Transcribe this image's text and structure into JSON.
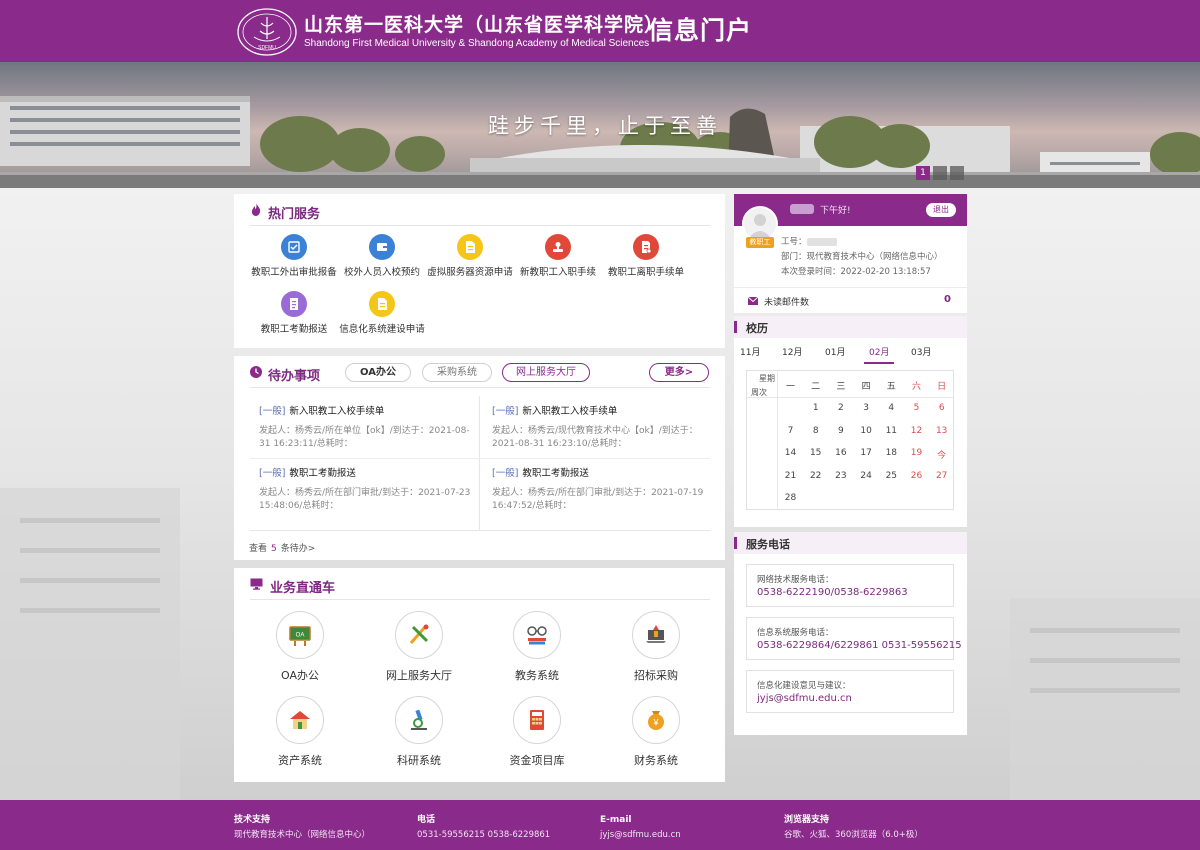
{
  "header": {
    "school_cn": "山东第一医科大学（山东省医学科学院）",
    "school_en": "Shandong First Medical University  &  Shandong Academy of Medical Sciences",
    "seal_text": "SDFMU",
    "portal_title": "信息门户"
  },
  "banner": {
    "motto": "跬步千里，止于至善",
    "slide_current": "1"
  },
  "hot_services": {
    "title": "热门服务",
    "items": [
      {
        "label": "教职工外出审批报备",
        "color": "#3b82d6",
        "icon": "approval-icon"
      },
      {
        "label": "校外人员入校预约",
        "color": "#3b82d6",
        "icon": "visitor-icon"
      },
      {
        "label": "虚拟服务器资源申请",
        "color": "#f5c518",
        "icon": "server-icon"
      },
      {
        "label": "新教职工入职手续",
        "color": "#e0483a",
        "icon": "stamp-icon"
      },
      {
        "label": "教职工离职手续单",
        "color": "#e0483a",
        "icon": "document-icon"
      },
      {
        "label": "教职工考勤报送",
        "color": "#9a6ad6",
        "icon": "attendance-icon"
      },
      {
        "label": "信息化系统建设申请",
        "color": "#f5c518",
        "icon": "build-icon"
      }
    ]
  },
  "todo": {
    "title": "待办事项",
    "tabs": [
      "OA办公",
      "采购系统",
      "网上服务大厅"
    ],
    "more": "更多>",
    "items": [
      {
        "tag": "[一般]",
        "title": "新入职教工入校手续单",
        "meta": "发起人：杨秀云/所在单位【ok】/到达于：2021-08-31 16:23:11/总耗时："
      },
      {
        "tag": "[一般]",
        "title": "新入职教工入校手续单",
        "meta": "发起人：杨秀云/现代教育技术中心【ok】/到达于：2021-08-31 16:23:10/总耗时："
      },
      {
        "tag": "[一般]",
        "title": "教职工考勤报送",
        "meta": "发起人：杨秀云/所在部门审批/到达于：2021-07-23 15:48:06/总耗时："
      },
      {
        "tag": "[一般]",
        "title": "教职工考勤报送",
        "meta": "发起人：杨秀云/所在部门审批/到达于：2021-07-19 16:47:52/总耗时："
      }
    ],
    "see_prefix": "查看",
    "see_count": "5",
    "see_suffix": "条待办>"
  },
  "business": {
    "title": "业务直通车",
    "items": [
      {
        "label": "OA办公",
        "icon": "oa-board-icon"
      },
      {
        "label": "网上服务大厅",
        "icon": "tools-icon"
      },
      {
        "label": "教务系统",
        "icon": "glasses-book-icon"
      },
      {
        "label": "招标采购",
        "icon": "laptop-icon"
      },
      {
        "label": "资产系统",
        "icon": "house-icon"
      },
      {
        "label": "科研系统",
        "icon": "microscope-icon"
      },
      {
        "label": "资金项目库",
        "icon": "calculator-icon"
      },
      {
        "label": "财务系统",
        "icon": "money-bag-icon"
      }
    ]
  },
  "user": {
    "greeting": "下午好!",
    "logout": "退出",
    "role": "教职工",
    "id_label": "工号：",
    "dept_label": "部门：",
    "dept": "现代教育技术中心（网络信息中心）",
    "login_label": "本次登录时间：",
    "login_time": "2022-02-20 13:18:57",
    "mail_label": "未读邮件数",
    "mail_count": "0"
  },
  "calendar": {
    "title": "校历",
    "months": [
      "11月",
      "12月",
      "01月",
      "02月",
      "03月"
    ],
    "active_month": "02月",
    "corner_week": "星期",
    "corner_cycle": "周次",
    "weekdays": [
      "一",
      "二",
      "三",
      "四",
      "五",
      "六",
      "日"
    ],
    "weeks": [
      [
        "",
        "1",
        "2",
        "3",
        "4",
        "5",
        "6"
      ],
      [
        "7",
        "8",
        "9",
        "10",
        "11",
        "12",
        "13"
      ],
      [
        "14",
        "15",
        "16",
        "17",
        "18",
        "19",
        "今"
      ],
      [
        "21",
        "22",
        "23",
        "24",
        "25",
        "26",
        "27"
      ],
      [
        "28",
        "",
        "",
        "",
        "",
        "",
        ""
      ]
    ]
  },
  "service_phone": {
    "title": "服务电话",
    "items": [
      {
        "label": "网络技术服务电话：",
        "value": "0538-6222190/0538-6229863"
      },
      {
        "label": "信息系统服务电话：",
        "value": "0538-6229864/6229861 0531-59556215"
      },
      {
        "label": "信息化建设意见与建议：",
        "value": "jyjs@sdfmu.edu.cn"
      }
    ]
  },
  "footer": {
    "cols": [
      {
        "h": "技术支持",
        "v": "现代教育技术中心（网络信息中心）"
      },
      {
        "h": "电话",
        "v": "0531-59556215 0538-6229861"
      },
      {
        "h": "E-mail",
        "v": "jyjs@sdfmu.edu.cn"
      },
      {
        "h": "浏览器支持",
        "v": "谷歌、火狐、360浏览器（6.0+极）"
      }
    ]
  },
  "colors": {
    "brand": "#8a2a8a",
    "accent_text": "#7b2a7e",
    "weekend": "#d94c4c"
  }
}
